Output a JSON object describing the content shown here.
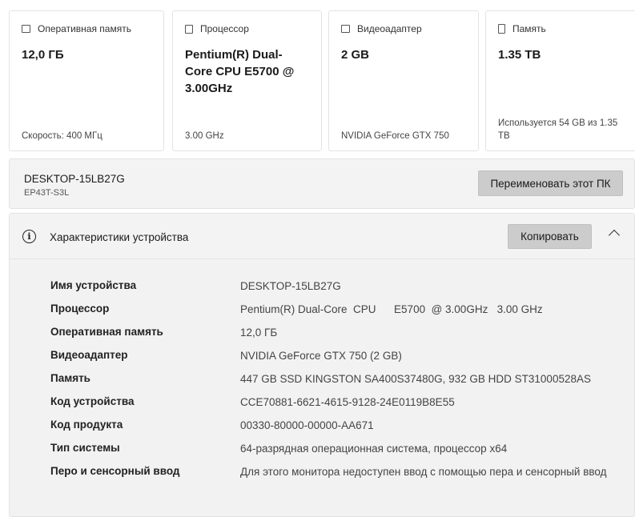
{
  "cards": [
    {
      "label": "Оперативная память",
      "value": "12,0 ГБ",
      "sub": "Скорость: 400 МГц",
      "icon": "ram-icon"
    },
    {
      "label": "Процессор",
      "value": "Pentium(R) Dual-Core CPU E5700 @ 3.00GHz",
      "sub": "3.00 GHz",
      "icon": "cpu-icon"
    },
    {
      "label": "Видеоадаптер",
      "value": "2 GB",
      "sub": "NVIDIA GeForce GTX 750",
      "icon": "gpu-icon"
    },
    {
      "label": "Память",
      "value": "1.35 TB",
      "sub": "Используется 54 GB из 1.35 TB",
      "icon": "storage-icon"
    }
  ],
  "pc": {
    "name": "DESKTOP-15LB27G",
    "model": "EP43T-S3L",
    "rename_label": "Переименовать этот ПК"
  },
  "specs": {
    "title": "Характеристики устройства",
    "copy_label": "Копировать",
    "rows": [
      {
        "k": "Имя устройства",
        "v": "DESKTOP-15LB27G"
      },
      {
        "k": "Процессор",
        "v": "Pentium(R) Dual-Core  CPU      E5700  @ 3.00GHz   3.00 GHz"
      },
      {
        "k": "Оперативная память",
        "v": "12,0 ГБ"
      },
      {
        "k": "Видеоадаптер",
        "v": "NVIDIA GeForce GTX 750 (2 GB)"
      },
      {
        "k": "Память",
        "v": "447 GB SSD KINGSTON SA400S37480G, 932 GB HDD ST31000528AS"
      },
      {
        "k": "Код устройства",
        "v": "CCE70881-6621-4615-9128-24E0119B8E55"
      },
      {
        "k": "Код продукта",
        "v": "00330-80000-00000-AA671"
      },
      {
        "k": "Тип системы",
        "v": "64-разрядная операционная система, процессор x64"
      },
      {
        "k": "Перо и сенсорный ввод",
        "v": "Для этого монитора недоступен ввод с помощью пера и сенсорный ввод"
      }
    ]
  }
}
